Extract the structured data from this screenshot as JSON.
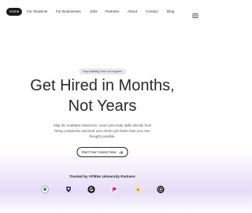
{
  "nav": {
    "items": [
      "Home",
      "For Students",
      "For Businesses",
      "Jobs",
      "Partners",
      "About",
      "Contact",
      "Blog"
    ],
    "menu_icon": "grid-menu-icon"
  },
  "hero": {
    "badge": "Stop Wasting Time on Degrees",
    "title_line1": "Get Hired in Months,",
    "title_line2": "Not Years",
    "subtitle": "Skip the outdated classroom. Learn job-ready skills directly from hiring companies and land your dream job faster than you ever thought possible.",
    "cta_label": "Start Your Career Now",
    "cta_icon": "arrow-right-icon"
  },
  "partners": {
    "title": "Trusted by VFlitter University Partners",
    "logos": [
      "university-crest-logo",
      "shield-emblem-logo",
      "g-circle-logo",
      "pink-stack-logo",
      "gold-emblem-logo",
      "round-crest-logo"
    ]
  },
  "colors": {
    "nav_active_bg": "#1a1a1a",
    "text_dark": "#2a2a2a",
    "bottom_gradient": "#e6dcf8"
  }
}
